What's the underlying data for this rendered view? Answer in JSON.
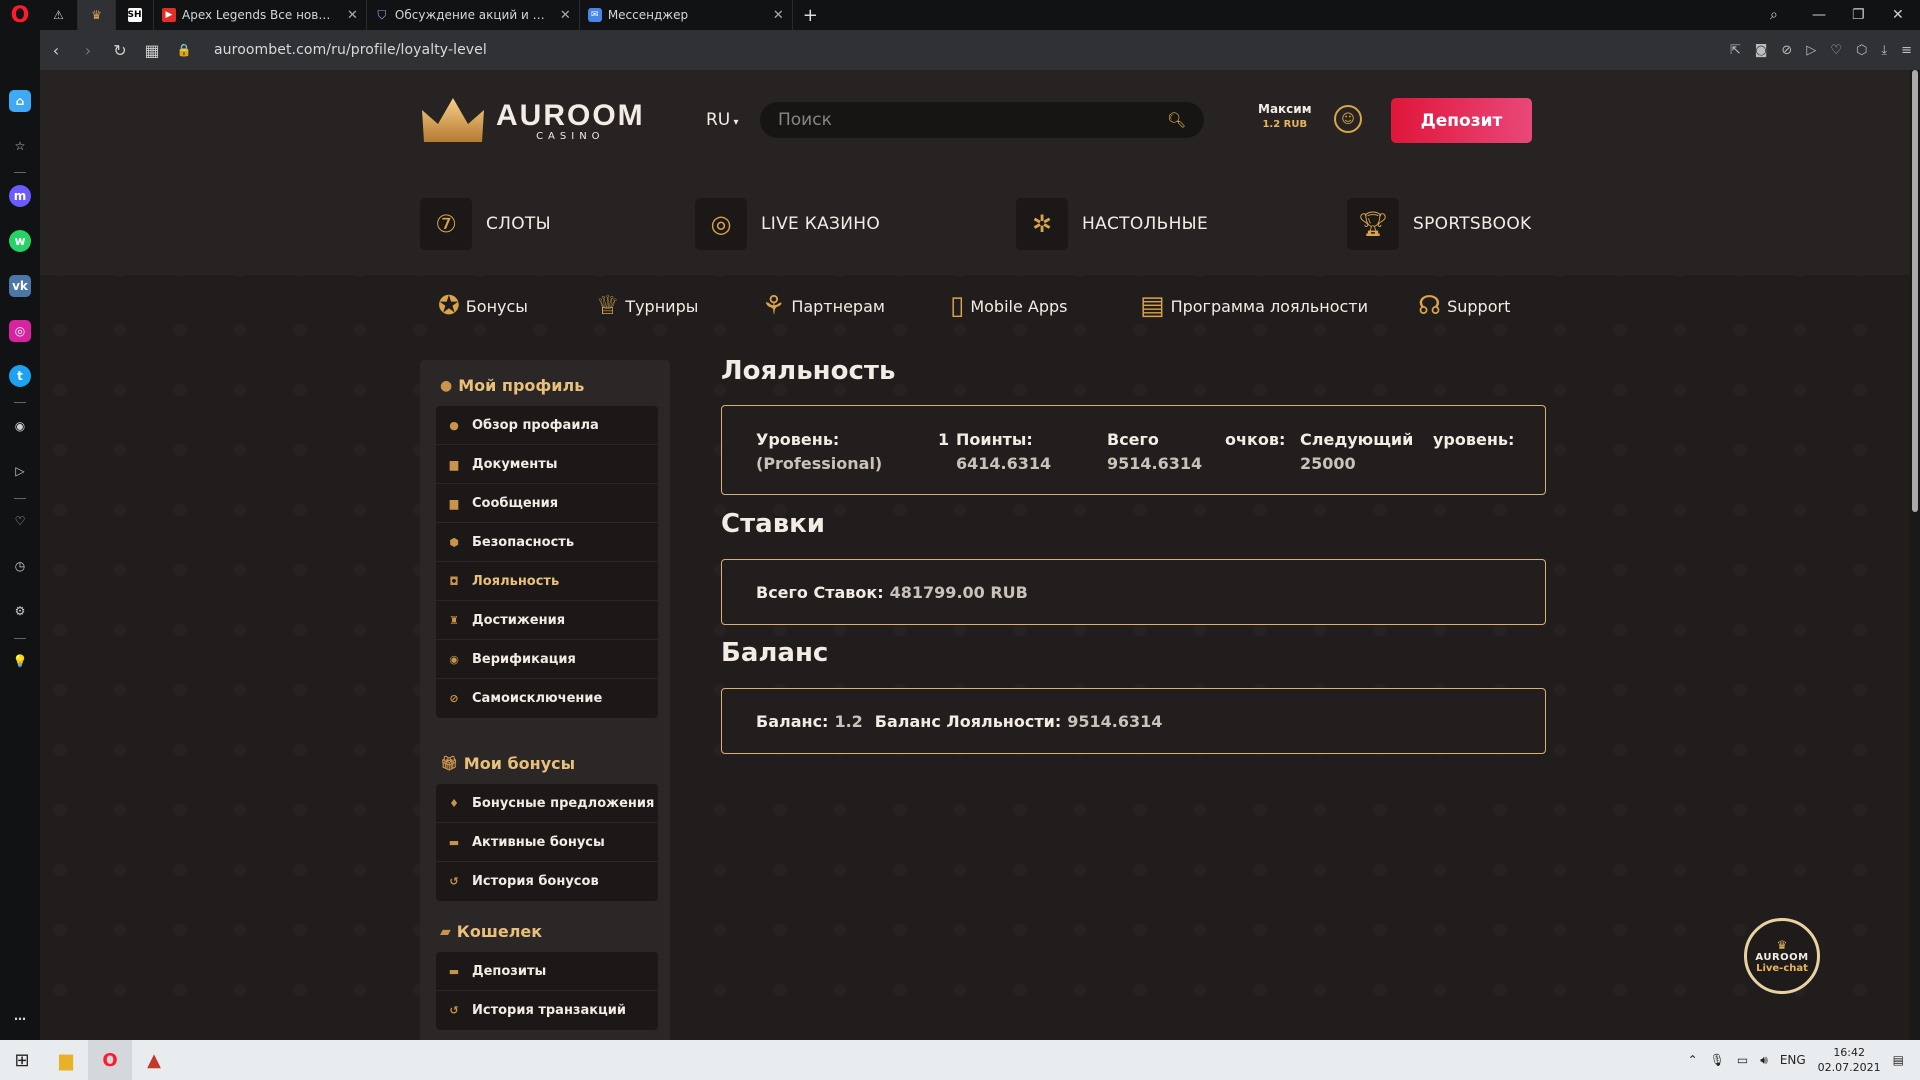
{
  "browser": {
    "tabs": [
      {
        "label": "",
        "icon": "warning-icon",
        "pinned": true
      },
      {
        "label": "",
        "icon": "crown-icon",
        "pinned": true,
        "active": true
      },
      {
        "label": "",
        "icon": "sh-icon",
        "pinned": true
      },
      {
        "label": "Apex Legends Все новые р",
        "icon": "youtube-icon"
      },
      {
        "label": "Обсуждение акций и конк",
        "icon": "shield-icon"
      },
      {
        "label": "Мессенджер",
        "icon": "messenger-icon"
      }
    ],
    "url": "auroombet.com/ru/profile/loyalty-level"
  },
  "header": {
    "logo_main": "AUROOM",
    "logo_sub": "CASINO",
    "lang": "RU",
    "search_placeholder": "Поиск",
    "user_name": "Максим",
    "user_balance": "1.2 RUB",
    "deposit_label": "Депозит"
  },
  "main_nav": [
    {
      "label": "СЛОТЫ",
      "icon": "slot-machine-icon"
    },
    {
      "label": "LIVE КАЗИНО",
      "icon": "chips-icon"
    },
    {
      "label": "НАСТОЛЬНЫЕ",
      "icon": "roulette-icon"
    },
    {
      "label": "SPORTSBOOK",
      "icon": "trophy-icon"
    }
  ],
  "sub_nav": [
    {
      "label": "Бонусы",
      "icon": "star-badge-icon"
    },
    {
      "label": "Турниры",
      "icon": "cup-icon"
    },
    {
      "label": "Партнерам",
      "icon": "handshake-icon"
    },
    {
      "label": "Mobile Apps",
      "icon": "phone-icon"
    },
    {
      "label": "Программа лояльности",
      "icon": "loyalty-icon"
    },
    {
      "label": "Support",
      "icon": "headset-icon"
    }
  ],
  "profile_sidebar": {
    "profile_title": "Мой профиль",
    "profile_items": [
      "Обзор профаила",
      "Документы",
      "Сообщения",
      "Безопасность",
      "Лояльность",
      "Достижения",
      "Верификация",
      "Самоисключение"
    ],
    "bonus_title": "Мои бонусы",
    "bonus_items": [
      "Бонусные предложения",
      "Активные бонусы",
      "История бонусов"
    ],
    "wallet_title": "Кошелек",
    "wallet_items": [
      "Депозиты",
      "История транзакций"
    ]
  },
  "loyalty": {
    "title": "Лояльность",
    "level_label": "Уровень:",
    "level_num": "1",
    "level_name": "(Professional)",
    "points_label": "Поинты:",
    "points_value": "6414.6314",
    "total_label_1": "Всего",
    "total_label_2": "очков:",
    "total_value": "9514.6314",
    "next_label_1": "Следующий",
    "next_label_2": "уровень:",
    "next_value": "25000"
  },
  "bets": {
    "title": "Ставки",
    "total_label": "Всего Ставок:",
    "total_value": "481799.00 RUB"
  },
  "balance": {
    "title": "Баланс",
    "balance_label": "Баланс:",
    "balance_value": "1.2",
    "loyalty_label": "Баланс Лояльности:",
    "loyalty_value": "9514.6314"
  },
  "livechat": {
    "line1": "AUROOM",
    "line2": "Live-chat"
  },
  "taskbar": {
    "lang": "ENG",
    "time": "16:42",
    "date": "02.07.2021"
  }
}
